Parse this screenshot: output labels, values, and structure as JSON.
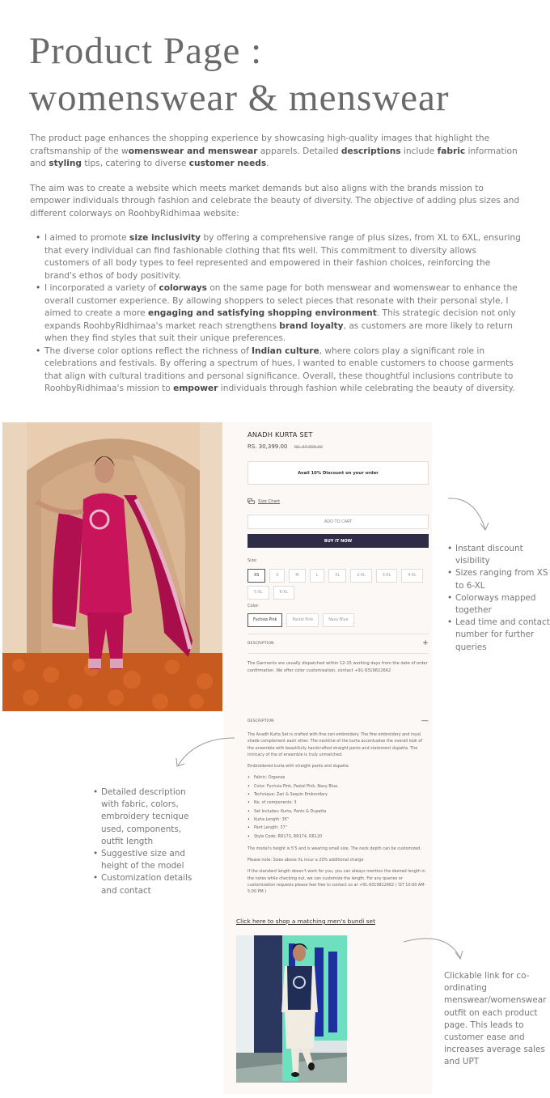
{
  "header": {
    "title_line1": "Product Page :",
    "title_line2": "womenswear & menswear"
  },
  "intro": {
    "p1": {
      "t1": "The product page enhances the shopping experience by showcasing high-quality images that highlight the craftsmanship of the w",
      "b1": "omenswear and menswear",
      "t2": " apparels. Detailed ",
      "b2": "descriptions",
      "t3": " include ",
      "b3": "fabric",
      "t4": " information and ",
      "b4": "styling",
      "t5": " tips, catering to diverse ",
      "b5": "customer needs",
      "t6": "."
    },
    "p2": "The aim was to create a website which meets market demands but also aligns with the brands mission to empower individuals through fashion and celebrate the beauty of diversity. The objective of adding plus sizes and different colorways on RoohbyRidhimaa website:",
    "bullets": [
      {
        "t1": "I aimed to promote ",
        "b1": "size inclusivity",
        "t2": " by offering a comprehensive range of plus sizes, from XL to 6XL, ensuring that every individual can find fashionable clothing that fits well. This commitment to diversity allows customers of all body types to feel represented and empowered in their fashion choices, reinforcing the brand's ethos of body positivity."
      },
      {
        "t1": "I incorporated a variety of ",
        "b1": "colorways",
        "t2": " on the same page for both menswear and womenswear to enhance the overall customer experience. By allowing shoppers to select pieces that resonate with their personal style, I aimed to create a more ",
        "b2": "engaging and satisfying shopping environment",
        "t3": ". This strategic decision not only expands RoohbyRidhimaa's market reach strengthens ",
        "b3": "brand loyalty",
        "t4": ", as customers are more likely to return when they find styles that suit their unique preferences."
      },
      {
        "t1": "The diverse color options reflect the richness of ",
        "b1": "Indian culture",
        "t2": ", where colors play a significant role in celebrations and festivals. By offering a spectrum of hues, I wanted to enable customers to choose garments that align with cultural traditions and personal significance. Overall, these thoughtful inclusions contribute to RoohbyRidhimaa's mission to ",
        "b2": "empower",
        "t3": " individuals through fashion while celebrating the beauty of diversity."
      }
    ]
  },
  "product": {
    "name": "ANADH KURTA SET",
    "price": "RS. 30,399.00",
    "old_price": "RS. 37,999.00",
    "discount_banner": "Avail 10% Discount on your order",
    "size_chart_label": "Size Chart",
    "add_to_cart_label": "ADD TO CART",
    "buy_now_label": "BUY IT NOW",
    "size_label": "Size:",
    "sizes": [
      "XS",
      "S",
      "M",
      "L",
      "XL",
      "2-XL",
      "3-XL",
      "4-XL",
      "5-XL",
      "6-XL"
    ],
    "selected_size": "XS",
    "color_label": "Color:",
    "colors": [
      "Fuchsia Pink",
      "Pastel Pink",
      "Navy Blue"
    ],
    "selected_color": "Fuchsia Pink",
    "description_heading": "DESCRIPTION",
    "collapsed_sign": "+",
    "expanded_sign": "—",
    "dispatch_note": "The Garments are usually dispatched within 12-15 working days from the date of order confirmation. We offer color customisation, contact +91-9319822662",
    "description": {
      "intro": "The Anadh Kurta Set is crafted with fine zari embroidery. The fine embroidery and royal shade complement each other. The neckline of the kurta accentuates the overall look of the ensemble with beautifully handcrafted straight pants and statement dupatta. The intricacy of the of ensemble is truly unmatched.",
      "subtitle": "Embroidered kurta with straight pants and dupatta",
      "specs": [
        "Fabric: Organza",
        "Color: Fuchsia Pink, Pastel Pink, Navy Blue,",
        "Technique: Zari & Sequin Embroidery",
        "No. of components: 3",
        "Set Includes: Kurta, Pants & Dupatta",
        "Kurta Length: 35\"",
        "Pant Length: 37\"",
        "Style Code: RR173, RR174, RR120"
      ],
      "model_note": "The model's height is 5'5 and is wearing small size. The neck depth can be customized.",
      "size_note": "Please note: Sizes above XL incur a 20% additional charge",
      "custom_note": "If the standard length doesn't work for you, you can always mention the desired length in the notes while checking out, we can customize the length. For any queries or customization requests please feel free to contact us at +91-9319822662 ( IST 10:00 AM- 5:00 PM )"
    },
    "matching_link": "Click here to shop a matching men's bundi set"
  },
  "annotations": {
    "right_top": [
      "Instant discount visibility",
      "Sizes ranging from XS to 6-XL",
      "Colorways mapped together",
      "Lead time and contact number for further queries"
    ],
    "left_mid": [
      "Detailed description with fabric, colors, embroidery tecnique used, components, outfit length",
      "Suggestive size and height of the model",
      "Customization details and contact"
    ],
    "right_bottom": "Clickable link for co-ordinating menswear/womenswear outfit on each product page. This leads to customer ease and increases average sales and UPT"
  },
  "colors": {
    "buy_button": "#2f2c47",
    "panel_bg": "#fcf8f6",
    "kurta_fuchsia": "#c8145a"
  }
}
